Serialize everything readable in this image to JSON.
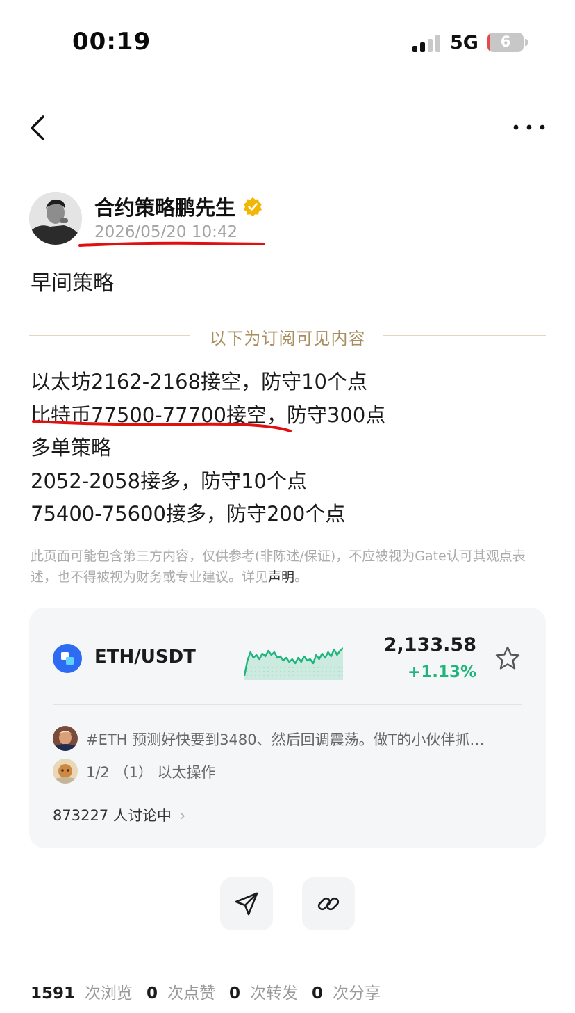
{
  "status_bar": {
    "time": "00:19",
    "network": "5G",
    "battery": "6",
    "battery_level": 0.06
  },
  "author": {
    "name": "合约策略鹏先生",
    "time": "2026/05/20 10:42"
  },
  "post": {
    "title": "早间策略",
    "subscription_label": "以下为订阅可见内容",
    "lines": [
      "以太坊2162-2168接空，防守10个点",
      "比特币77500-77700接空，防守300点",
      "多单策略",
      "2052-2058接多，防守10个点",
      "75400-75600接多，防守200个点"
    ],
    "disclaimer": "此页面可能包含第三方内容，仅供参考(非陈述/保证)，不应被视为Gate认可其观点表述，也不得被视为财务或专业建议。详见",
    "disclaimer_link": "声明",
    "disclaimer_end": "。"
  },
  "market": {
    "pair": "ETH/USDT",
    "price": "2,133.58",
    "change": "+1.13%",
    "change_color": "#1db57a",
    "sparkline": [
      52,
      30,
      18,
      26,
      22,
      28,
      20,
      24,
      16,
      22,
      18,
      26,
      24,
      30,
      26,
      32,
      28,
      34,
      26,
      32,
      24,
      30,
      28,
      34,
      22,
      28,
      20,
      26,
      18,
      24,
      14,
      22,
      16,
      12
    ],
    "feed": [
      "#ETH 预测好快要到3480、然后回调震荡。做T的小伙伴抓…",
      "1/2 （1） 以太操作"
    ],
    "discussion": "873227 人讨论中"
  },
  "stats": [
    {
      "value": "1591",
      "label": "次浏览"
    },
    {
      "value": "0",
      "label": "次点赞"
    },
    {
      "value": "0",
      "label": "次转发"
    },
    {
      "value": "0",
      "label": "次分享"
    }
  ],
  "icons": {
    "back": "chevron-left-icon",
    "more": "more-horizontal-icon",
    "verified": "verified-badge-icon",
    "star": "star-icon",
    "share": "send-icon",
    "link": "link-icon"
  }
}
